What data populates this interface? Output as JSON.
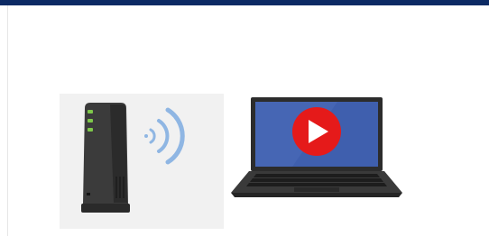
{
  "illustration": {
    "router_icon": "wifi-router-icon",
    "wifi_icon": "wifi-signal-icon",
    "laptop_icon": "laptop-icon",
    "play_icon": "video-play-icon"
  },
  "colors": {
    "top_bar": "#0c2a64",
    "router_body": "#3a3a3a",
    "router_led": "#7ec84a",
    "wifi_waves": "#8fb6e3",
    "laptop_screen": "#3f5fae",
    "play_button": "#e51a1a"
  }
}
